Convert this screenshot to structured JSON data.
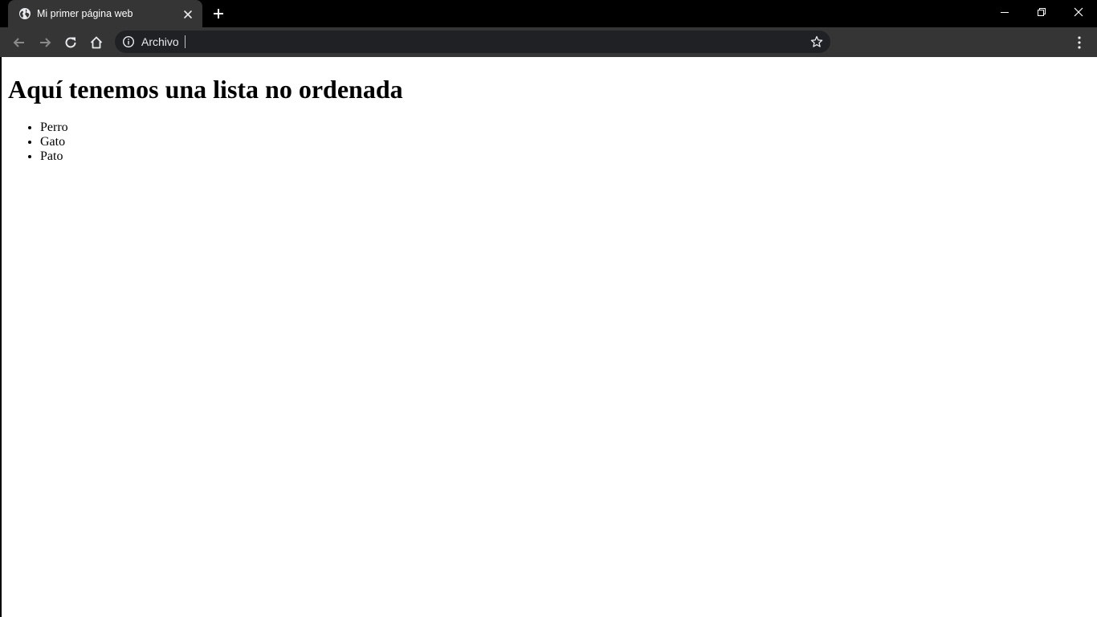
{
  "browser": {
    "tab": {
      "title": "Mi primer página web",
      "favicon": "globe-icon"
    },
    "new_tab_icon": "plus-icon",
    "window_controls": [
      "minimize-icon",
      "restore-icon",
      "close-icon"
    ],
    "toolbar": {
      "back_icon": "arrow-left-icon",
      "forward_icon": "arrow-right-icon",
      "reload_icon": "reload-icon",
      "home_icon": "home-icon",
      "menu_icon": "kebab-menu-icon"
    },
    "omnibox": {
      "info_icon": "info-icon",
      "text": "Archivo",
      "bookmark_icon": "star-icon"
    },
    "colors": {
      "tabstrip_bg": "#000000",
      "toolbar_bg": "#353535",
      "omnibox_bg": "#202124",
      "icon_color": "#e8eaed",
      "disabled_icon_color": "#8a8a8a"
    }
  },
  "page": {
    "heading": "Aquí tenemos una lista no ordenada",
    "list_items": [
      "Perro",
      "Gato",
      "Pato"
    ]
  }
}
